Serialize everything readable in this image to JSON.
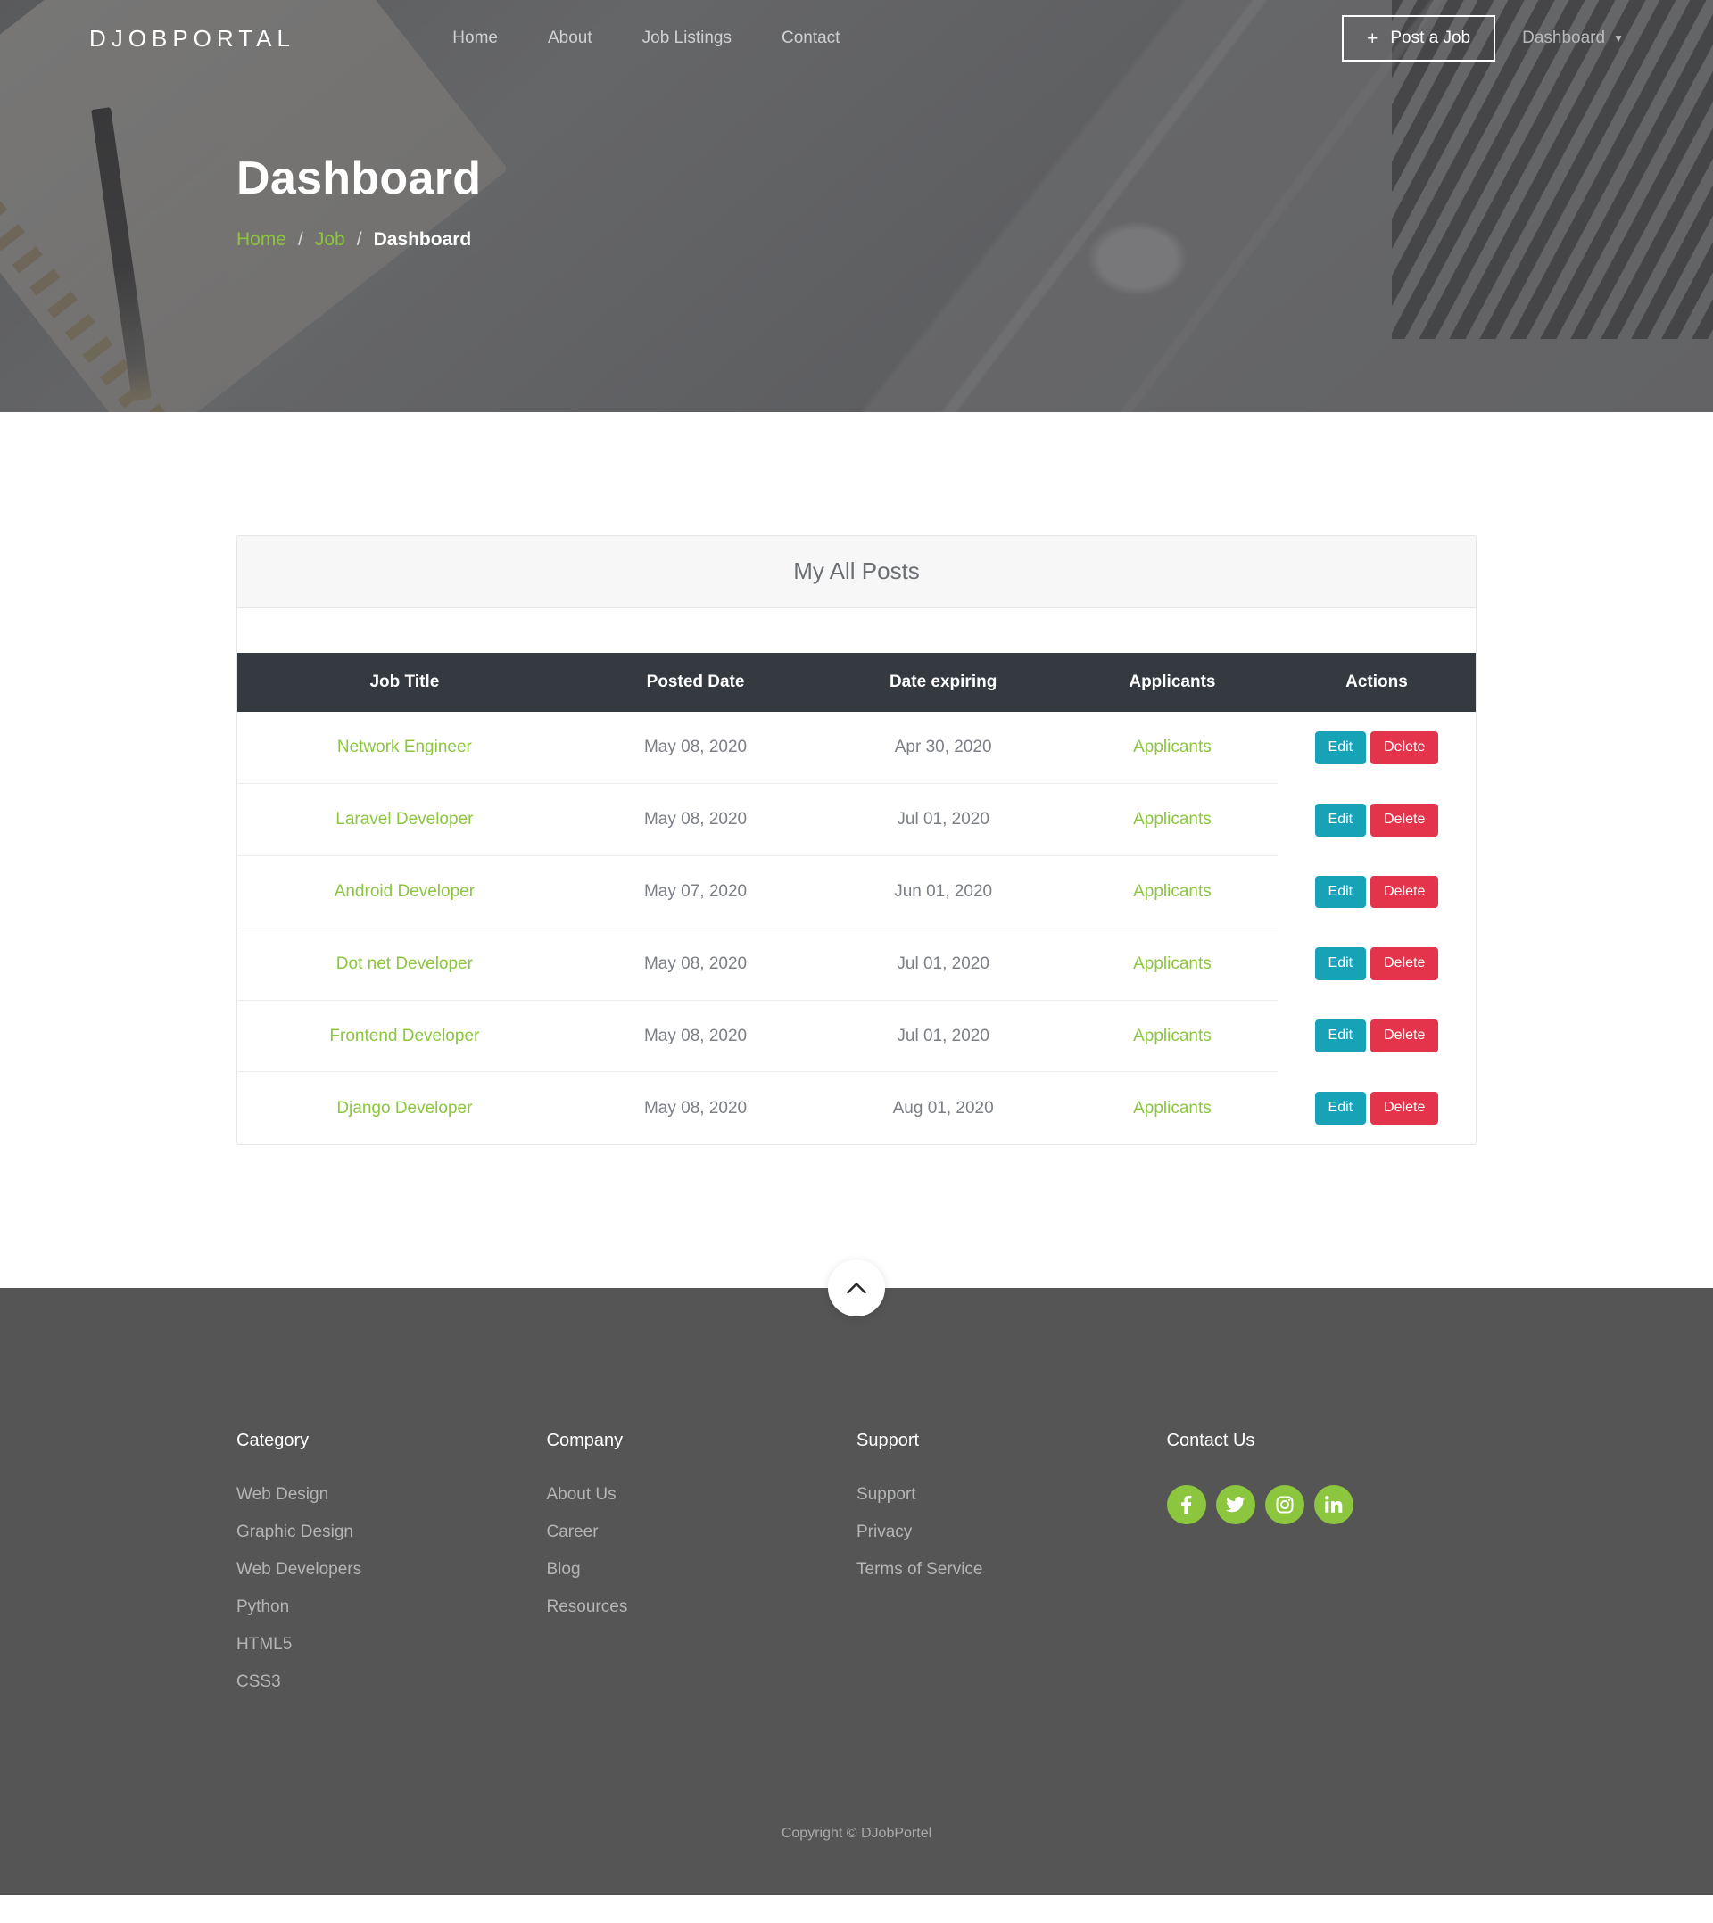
{
  "brand": {
    "logo": "DJOBPORTAL"
  },
  "nav": {
    "items": [
      {
        "label": "Home"
      },
      {
        "label": "About"
      },
      {
        "label": "Job Listings"
      },
      {
        "label": "Contact"
      }
    ],
    "post_job_label": "Post a Job",
    "post_job_icon": "plus-icon",
    "dashboard_label": "Dashboard",
    "dashboard_caret_icon": "chevron-down-icon"
  },
  "hero": {
    "title": "Dashboard",
    "breadcrumb": {
      "home": "Home",
      "job": "Job",
      "current": "Dashboard",
      "separator": "/"
    }
  },
  "card": {
    "title": "My All Posts",
    "table": {
      "columns": [
        "Job Title",
        "Posted Date",
        "Date expiring",
        "Applicants",
        "Actions"
      ],
      "rows": [
        {
          "job_title": "Network Engineer",
          "posted_date": "May 08, 2020",
          "date_expiring": "Apr 30, 2020",
          "applicants": "Applicants",
          "edit": "Edit",
          "delete": "Delete"
        },
        {
          "job_title": "Laravel Developer",
          "posted_date": "May 08, 2020",
          "date_expiring": "Jul 01, 2020",
          "applicants": "Applicants",
          "edit": "Edit",
          "delete": "Delete"
        },
        {
          "job_title": "Android Developer",
          "posted_date": "May 07, 2020",
          "date_expiring": "Jun 01, 2020",
          "applicants": "Applicants",
          "edit": "Edit",
          "delete": "Delete"
        },
        {
          "job_title": "Dot net Developer",
          "posted_date": "May 08, 2020",
          "date_expiring": "Jul 01, 2020",
          "applicants": "Applicants",
          "edit": "Edit",
          "delete": "Delete"
        },
        {
          "job_title": "Frontend Developer",
          "posted_date": "May 08, 2020",
          "date_expiring": "Jul 01, 2020",
          "applicants": "Applicants",
          "edit": "Edit",
          "delete": "Delete"
        },
        {
          "job_title": "Django Developer",
          "posted_date": "May 08, 2020",
          "date_expiring": "Aug 01, 2020",
          "applicants": "Applicants",
          "edit": "Edit",
          "delete": "Delete"
        }
      ]
    }
  },
  "scroll_top": {
    "icon": "chevron-up-icon"
  },
  "footer": {
    "columns": [
      {
        "heading": "Category",
        "links": [
          "Web Design",
          "Graphic Design",
          "Web Developers",
          "Python",
          "HTML5",
          "CSS3"
        ]
      },
      {
        "heading": "Company",
        "links": [
          "About Us",
          "Career",
          "Blog",
          "Resources"
        ]
      },
      {
        "heading": "Support",
        "links": [
          "Support",
          "Privacy",
          "Terms of Service"
        ]
      }
    ],
    "contact": {
      "heading": "Contact Us",
      "socials": [
        {
          "name": "facebook-icon"
        },
        {
          "name": "twitter-icon"
        },
        {
          "name": "instagram-icon"
        },
        {
          "name": "linkedin-icon"
        }
      ]
    },
    "copyright": "Copyright © DJobPortel"
  },
  "colors": {
    "accent_green": "#8cc63e",
    "table_header": "#343a40",
    "edit_button": "#17a2b8",
    "delete_button": "#e3344b",
    "footer_bg": "#555555"
  }
}
